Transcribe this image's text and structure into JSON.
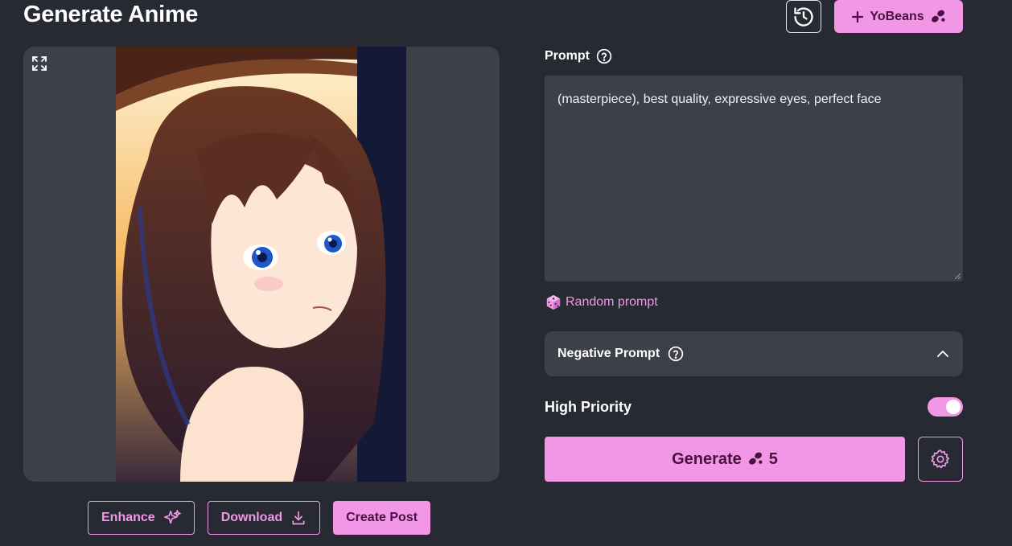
{
  "header": {
    "title": "Generate Anime",
    "yobeans_label": "YoBeans"
  },
  "image_actions": {
    "enhance_label": "Enhance",
    "download_label": "Download",
    "create_post_label": "Create Post"
  },
  "prompt": {
    "label": "Prompt",
    "value": "(masterpiece), best quality, expressive eyes, perfect face",
    "random_label": "Random prompt"
  },
  "negative_prompt": {
    "label": "Negative Prompt",
    "expanded": false
  },
  "priority": {
    "label": "High Priority",
    "enabled": true
  },
  "generate": {
    "label": "Generate",
    "cost": "5"
  },
  "colors": {
    "background": "#282a33",
    "panel": "#3e4049",
    "accent": "#f197e6",
    "accent_text": "#4a1042"
  },
  "icons": {
    "history": "history-icon",
    "plus": "plus-icon",
    "bean": "bean-icon",
    "expand": "expand-icon",
    "sparkle": "sparkle-icon",
    "download": "download-icon",
    "help": "help-circle-icon",
    "dice": "dice-icon",
    "chevron": "chevron-up-icon",
    "gear": "gear-icon"
  }
}
